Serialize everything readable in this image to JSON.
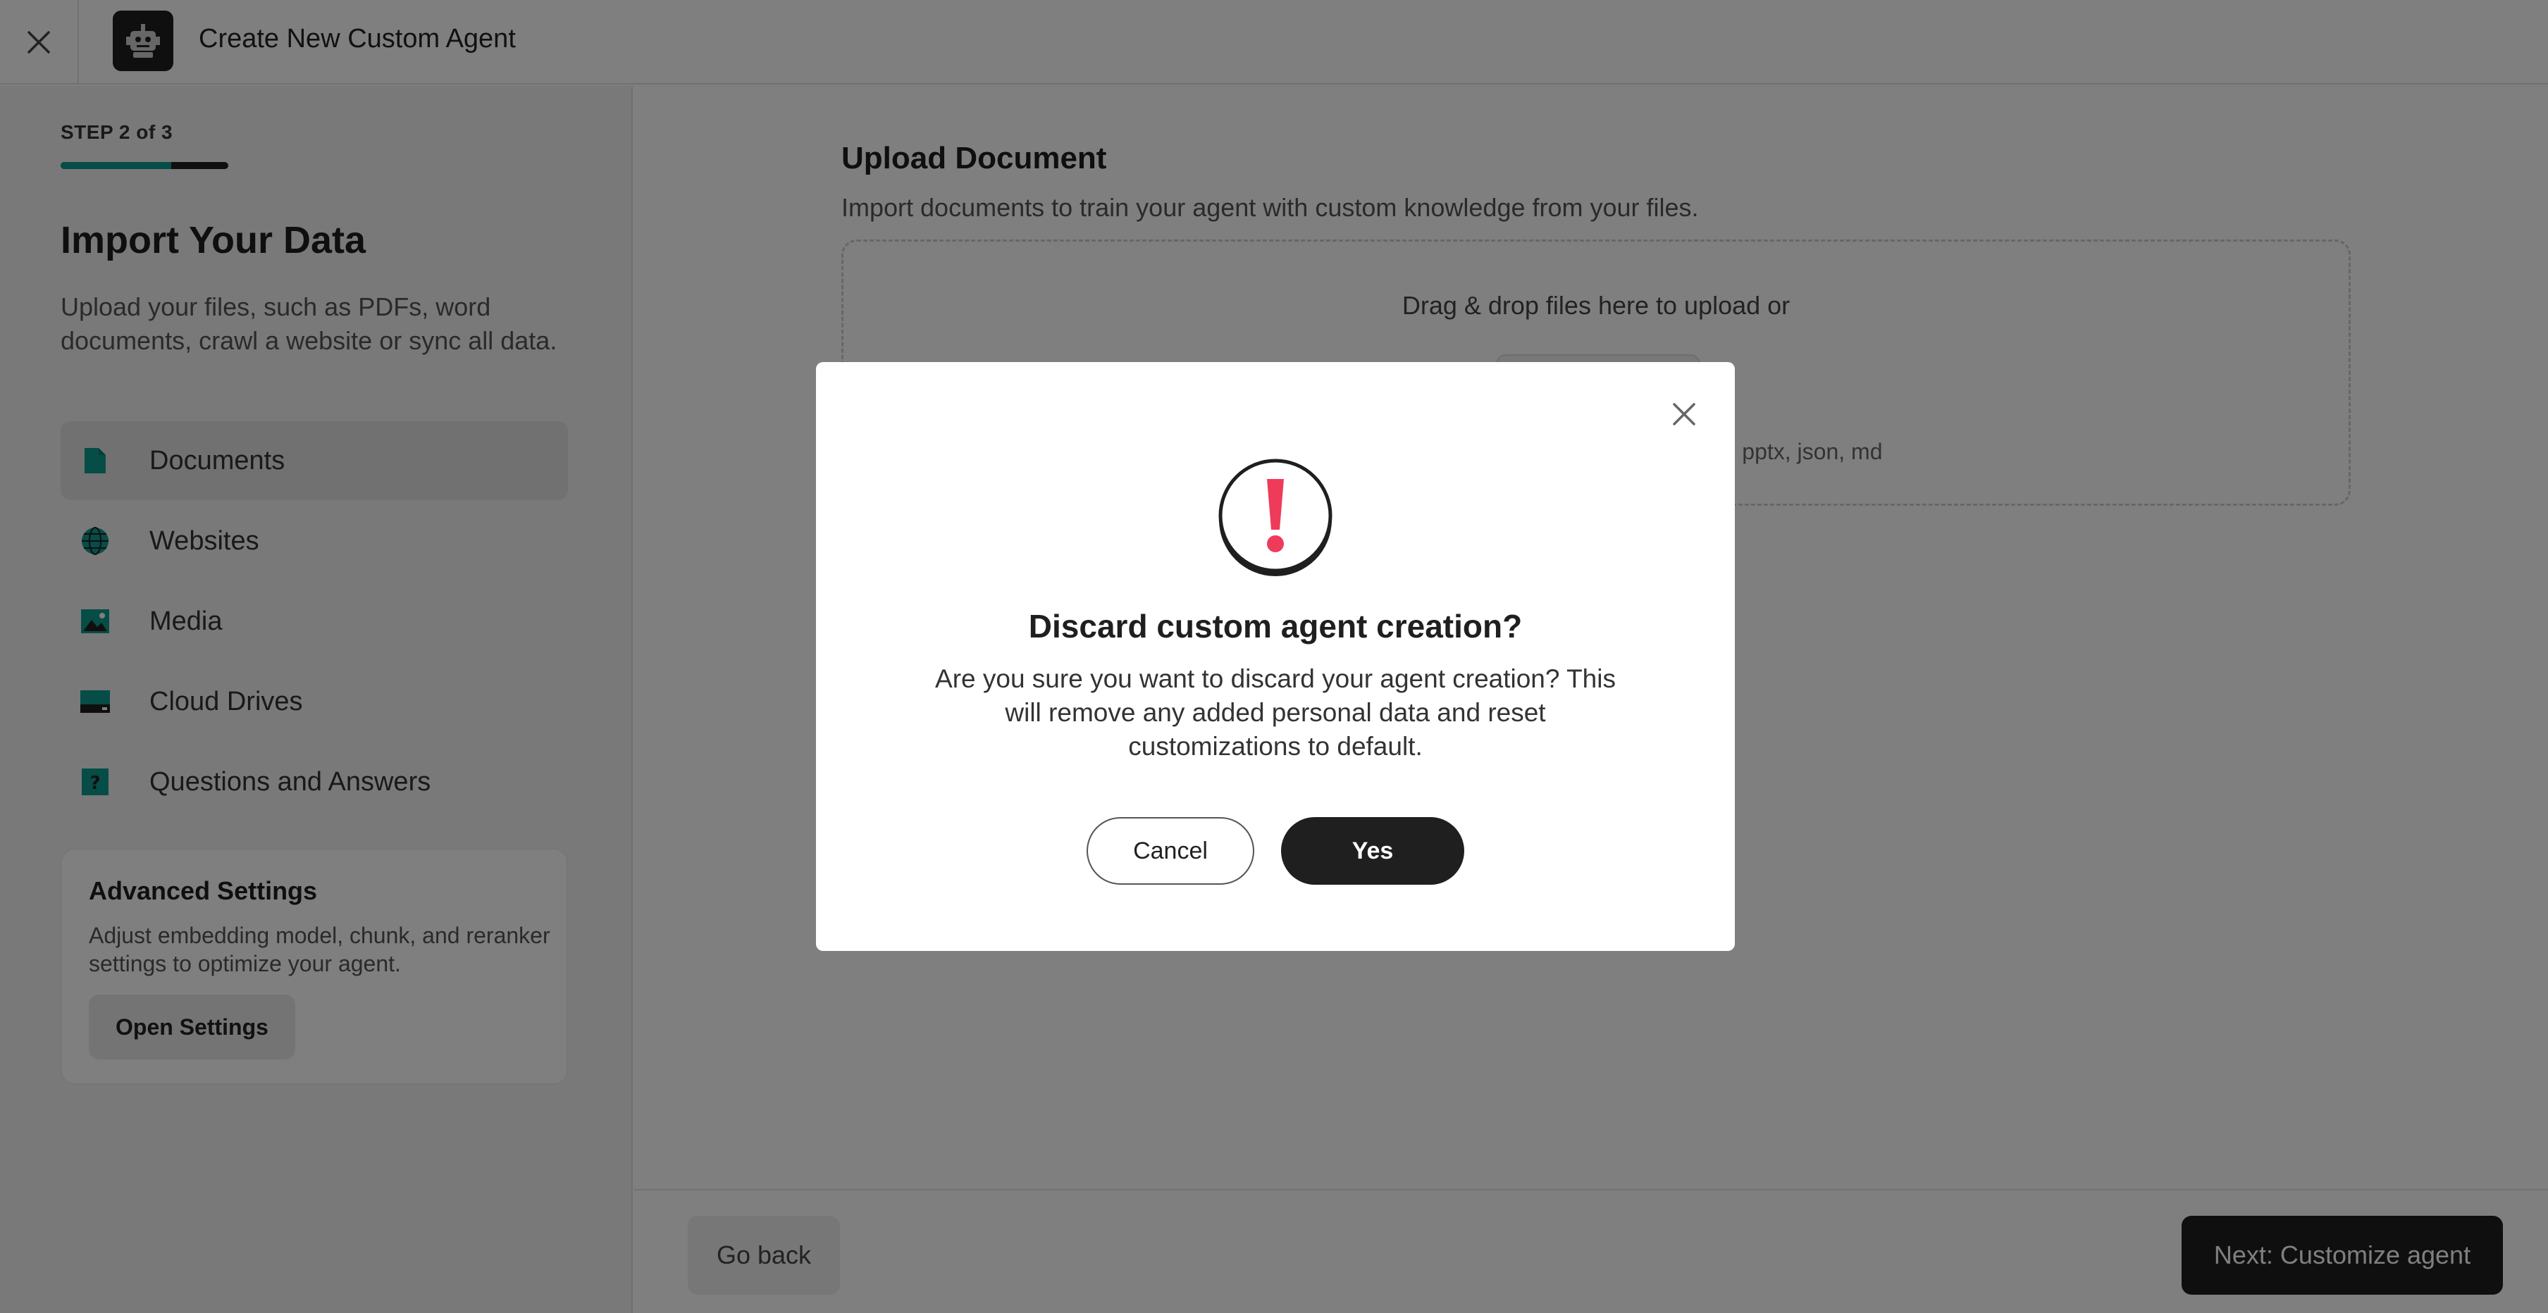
{
  "header": {
    "title": "Create New Custom Agent",
    "close_icon": "close-icon",
    "logo_icon": "robot-icon"
  },
  "sidebar": {
    "step": "STEP 2 of 3",
    "progress": 0.66,
    "heading": "Import Your Data",
    "description": "Upload your files, such as PDFs, word documents, crawl a website or sync all data.",
    "items": [
      {
        "label": "Documents",
        "icon": "document-icon",
        "active": true
      },
      {
        "label": "Websites",
        "icon": "globe-icon",
        "active": false
      },
      {
        "label": "Media",
        "icon": "image-icon",
        "active": false
      },
      {
        "label": "Cloud Drives",
        "icon": "drive-icon",
        "active": false
      },
      {
        "label": "Questions and Answers",
        "icon": "question-icon",
        "active": false
      }
    ],
    "advanced": {
      "title": "Advanced Settings",
      "description": "Adjust embedding model, chunk, and reranker settings to optimize your agent.",
      "button": "Open Settings"
    }
  },
  "main": {
    "title": "Upload Document",
    "description": "Import documents to train your agent with custom knowledge from your files.",
    "dropzone": {
      "text": "Drag & drop files here to upload or",
      "formats": "x, pptx, json, md"
    }
  },
  "footer": {
    "back": "Go back",
    "next": "Next: Customize agent"
  },
  "modal": {
    "title": "Discard custom agent creation?",
    "body": "Are you sure you want to discard your agent creation? This will remove any added personal data and reset customizations to default.",
    "cancel": "Cancel",
    "confirm": "Yes",
    "icon": "warning-icon"
  },
  "colors": {
    "accent": "#0f9b8e",
    "dark": "#1f1f1f",
    "warning": "#ef3b5a"
  }
}
